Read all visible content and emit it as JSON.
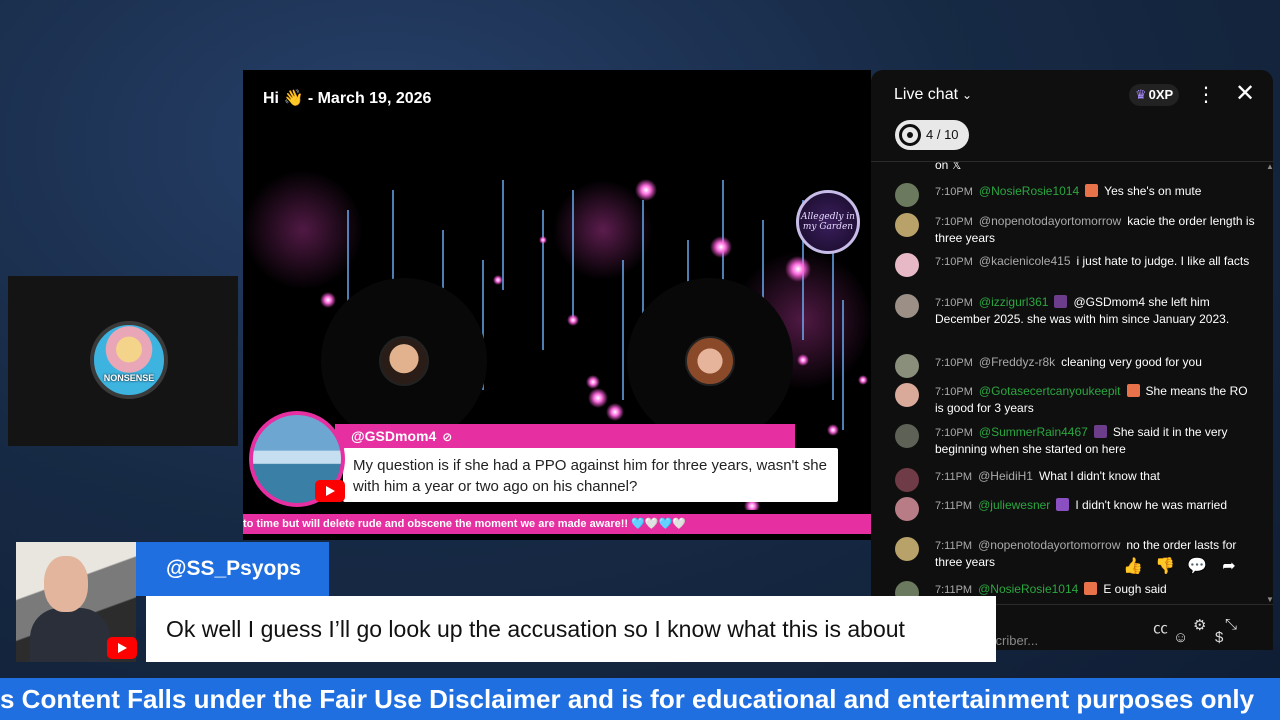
{
  "stream": {
    "title": "Hi 👋 - March 19, 2026",
    "logo_text": "Allegedly in my Garden",
    "question": {
      "user": "@GSDmom4",
      "text": "My question is if she had a PPO against him for three years, wasn't she with him a year or two ago on his channel?"
    },
    "ticker": "to time but will delete rude and obscene the moment we are made aware!! 🩵🤍🩵🤍"
  },
  "host_cam": {
    "avatar_text": "NONSENSE"
  },
  "chat": {
    "title": "Live chat",
    "xp": "0XP",
    "goal": "4 / 10",
    "top_fragment": "on 𝕏",
    "messages": [
      {
        "time": "7:10PM",
        "author": "@NosieRosie1014",
        "author_color": "green",
        "badge": "#e8734a",
        "text": "Yes she's on mute",
        "avatar": "#6b7a5e"
      },
      {
        "time": "7:10PM",
        "author": "@nopenotodayortomorrow",
        "author_color": "gray",
        "badge": "",
        "text": "kacie the order length is three years",
        "avatar": "#b9a26a"
      },
      {
        "time": "7:10PM",
        "author": "@kacienicole415",
        "author_color": "gray",
        "badge": "",
        "text": "i just hate to judge. I like all facts",
        "avatar": "#e7b9c7"
      },
      {
        "time": "7:10PM",
        "author": "@izzigurl361",
        "author_color": "green",
        "badge": "#6b3d8a",
        "text": "@GSDmom4 she left him December 2025. she was with him since January 2023.",
        "avatar": "#9c8f86"
      },
      {
        "time": "7:10PM",
        "author": "@Freddyz-r8k",
        "author_color": "gray",
        "badge": "",
        "text": "cleaning very good for you",
        "avatar": "#8a8f7c"
      },
      {
        "time": "7:10PM",
        "author": "@Gotasecertcanyoukeepit",
        "author_color": "green",
        "badge": "#e8734a",
        "text": "She means the RO is good for 3 years",
        "avatar": "#d9a99a"
      },
      {
        "time": "7:10PM",
        "author": "@SummerRain4467",
        "author_color": "green",
        "badge": "#6b3d8a",
        "text": "She said it in the very beginning when she started on here",
        "avatar": "#5e6256"
      },
      {
        "time": "7:11PM",
        "author": "@HeidiH1",
        "author_color": "gray",
        "badge": "",
        "text": "What I didn't know that",
        "avatar": "#6e3b47"
      },
      {
        "time": "7:11PM",
        "author": "@juliewesner",
        "author_color": "green",
        "badge": "#8a4fc0",
        "text": "I didn't know he was married",
        "avatar": "#b77c86"
      },
      {
        "time": "7:11PM",
        "author": "@nopenotodayortomorrow",
        "author_color": "gray",
        "badge": "",
        "text": "no the order lasts for three years",
        "avatar": "#b9a26a"
      },
      {
        "time": "7:11PM",
        "author": "@NosieRosie1014",
        "author_color": "green",
        "badge": "#e8734a",
        "text": "E ough said",
        "avatar": "#6b7a5e"
      }
    ],
    "input_placeholder": "scriber..."
  },
  "comment": {
    "user": "@SS_Psyops",
    "text": "Ok well I guess I’ll go look up the accusation so I know what this is about"
  },
  "ticker": "s Content Falls under the Fair Use Disclaimer and is for educational and entertainment purposes only"
}
